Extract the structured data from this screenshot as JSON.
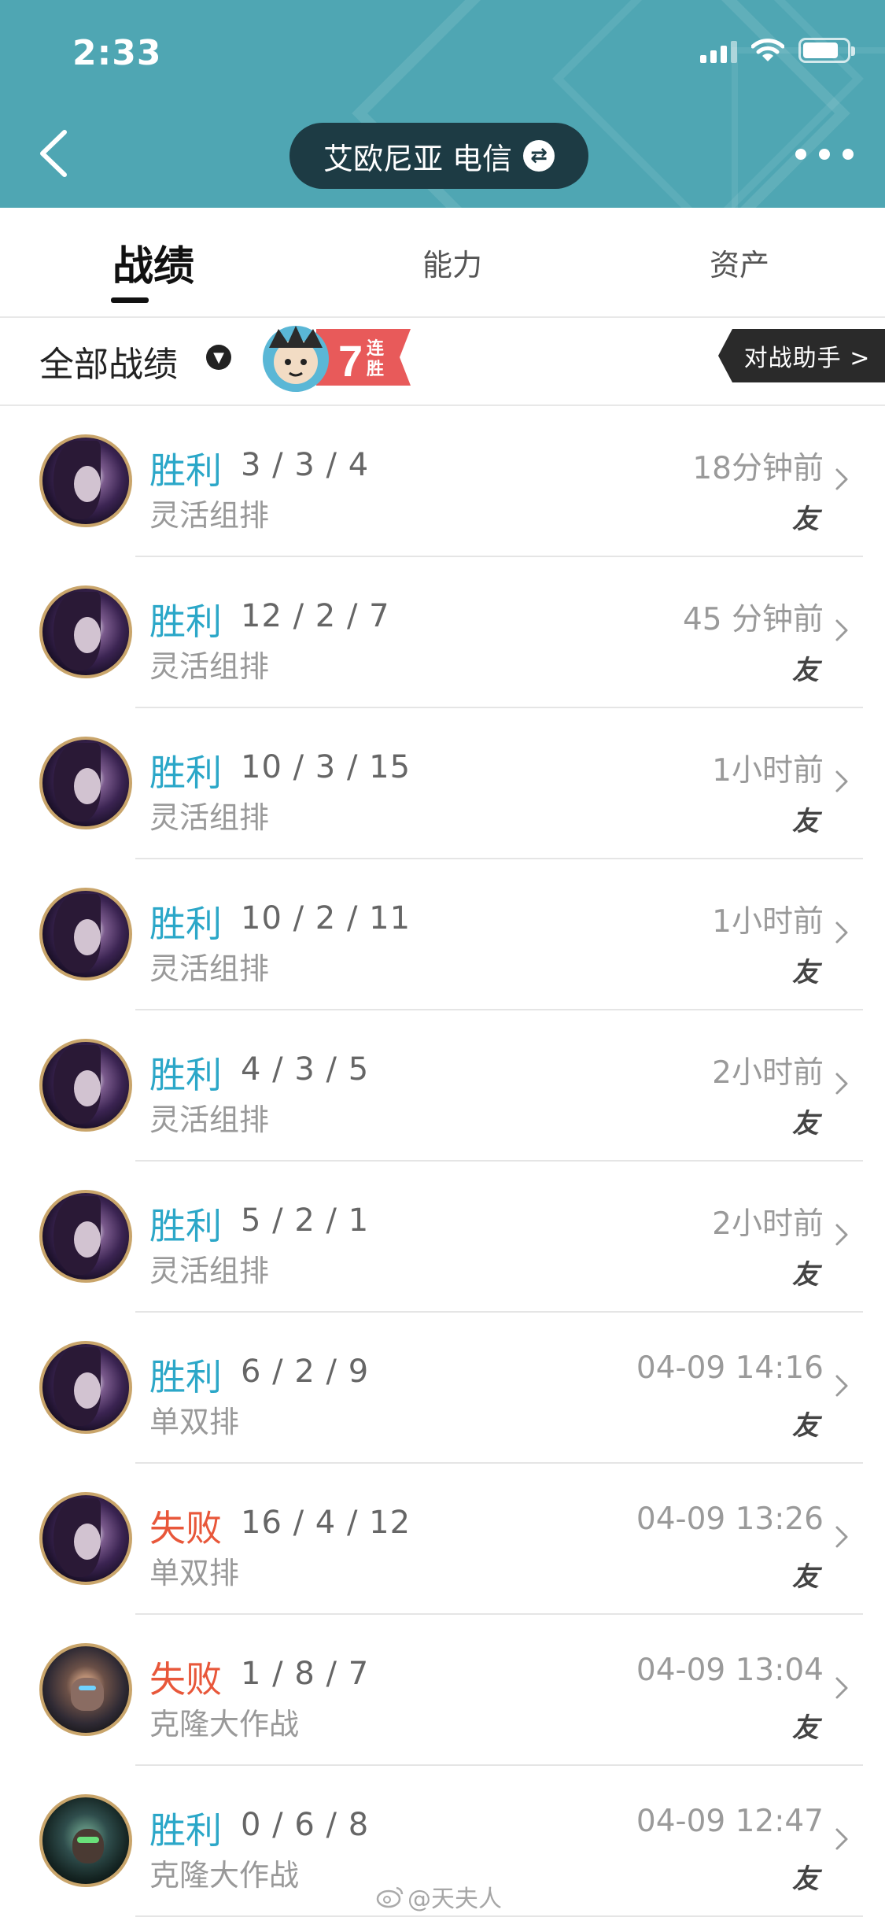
{
  "status_bar": {
    "time": "2:33"
  },
  "header": {
    "server": "艾欧尼亚 电信",
    "colors": {
      "header_bg": "#4fa6b3",
      "pill_bg": "#1d3b44"
    }
  },
  "tabs": [
    {
      "label": "战绩",
      "active": true
    },
    {
      "label": "能力",
      "active": false
    },
    {
      "label": "资产",
      "active": false
    }
  ],
  "filter": {
    "label": "全部战绩",
    "streak_number": "7",
    "streak_text_1": "连",
    "streak_text_2": "胜",
    "assistant_label": "对战助手 >"
  },
  "matches": [
    {
      "result": "胜利",
      "outcome": "win",
      "kda": "3 / 3 / 4",
      "mode": "灵活组排",
      "time": "18分钟前",
      "tag": "友",
      "champion_icon": "kaisa"
    },
    {
      "result": "胜利",
      "outcome": "win",
      "kda": "12 / 2 / 7",
      "mode": "灵活组排",
      "time": "45 分钟前",
      "tag": "友",
      "champion_icon": "kaisa"
    },
    {
      "result": "胜利",
      "outcome": "win",
      "kda": "10 / 3 / 15",
      "mode": "灵活组排",
      "time": "1小时前",
      "tag": "友",
      "champion_icon": "kaisa"
    },
    {
      "result": "胜利",
      "outcome": "win",
      "kda": "10 / 2 / 11",
      "mode": "灵活组排",
      "time": "1小时前",
      "tag": "友",
      "champion_icon": "kaisa"
    },
    {
      "result": "胜利",
      "outcome": "win",
      "kda": "4 / 3 / 5",
      "mode": "灵活组排",
      "time": "2小时前",
      "tag": "友",
      "champion_icon": "kaisa"
    },
    {
      "result": "胜利",
      "outcome": "win",
      "kda": "5 / 2 / 1",
      "mode": "灵活组排",
      "time": "2小时前",
      "tag": "友",
      "champion_icon": "kaisa"
    },
    {
      "result": "胜利",
      "outcome": "win",
      "kda": "6 / 2 / 9",
      "mode": "单双排",
      "time": "04-09 14:16",
      "tag": "友",
      "champion_icon": "kaisa"
    },
    {
      "result": "失败",
      "outcome": "loss",
      "kda": "16 / 4 / 12",
      "mode": "单双排",
      "time": "04-09 13:26",
      "tag": "友",
      "champion_icon": "kaisa"
    },
    {
      "result": "失败",
      "outcome": "loss",
      "kda": "1 / 8 / 7",
      "mode": "克隆大作战",
      "time": "04-09 13:04",
      "tag": "友",
      "champion_icon": "sylas"
    },
    {
      "result": "胜利",
      "outcome": "win",
      "kda": "0 / 6 / 8",
      "mode": "克隆大作战",
      "time": "04-09 12:47",
      "tag": "友",
      "champion_icon": "ekko"
    }
  ],
  "watermark": "@天夫人",
  "colors": {
    "win": "#2ba7c8",
    "loss": "#e8573a"
  }
}
